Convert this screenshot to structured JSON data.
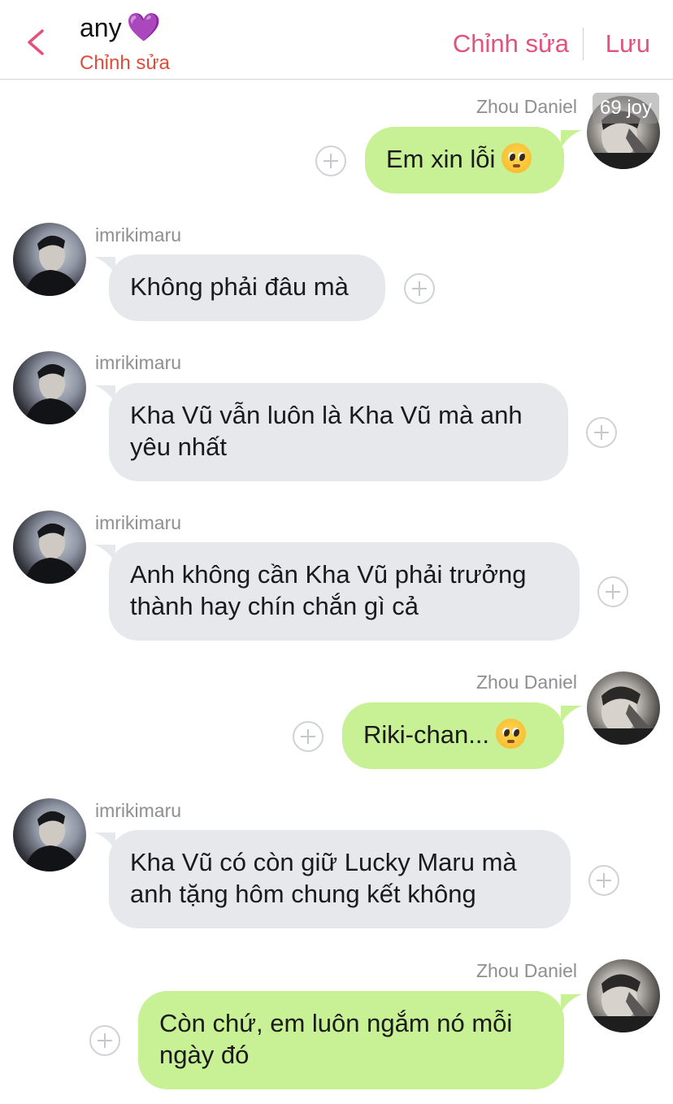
{
  "header": {
    "title": "any",
    "title_emoji": "💜",
    "subtitle": "Chỉnh sửa",
    "edit_label": "Chỉnh sửa",
    "save_label": "Lưu"
  },
  "badge": "69 joy",
  "messages": [
    {
      "side": "out",
      "sender": "Zhou Daniel",
      "text": "Em xin lỗi",
      "emoji": "pleading-face"
    },
    {
      "side": "in",
      "sender": "imrikimaru",
      "text": "Không phải đâu mà"
    },
    {
      "side": "in",
      "sender": "imrikimaru",
      "line1": "Kha Vũ vẫn luôn là Kha Vũ mà anh",
      "line2": "yêu nhất"
    },
    {
      "side": "in",
      "sender": "imrikimaru",
      "line1": "Anh không cần Kha Vũ phải trưởng",
      "line2": "thành hay chín chắn gì cả"
    },
    {
      "side": "out",
      "sender": "Zhou Daniel",
      "text": "Riki-chan...",
      "emoji": "pleading-face"
    },
    {
      "side": "in",
      "sender": "imrikimaru",
      "line1": "Kha Vũ có còn giữ Lucky Maru mà",
      "line2": "anh tặng hôm chung kết không"
    },
    {
      "side": "out",
      "sender": "Zhou Daniel",
      "line1": "Còn chứ, em luôn ngắm nó mỗi",
      "line2": "ngày đó"
    }
  ],
  "colors": {
    "accent": "#e4527b",
    "subtitle": "#e04c3c",
    "incoming_bubble": "#e6e8ec",
    "outgoing_bubble": "#c8f094",
    "name": "#8e8e93"
  }
}
